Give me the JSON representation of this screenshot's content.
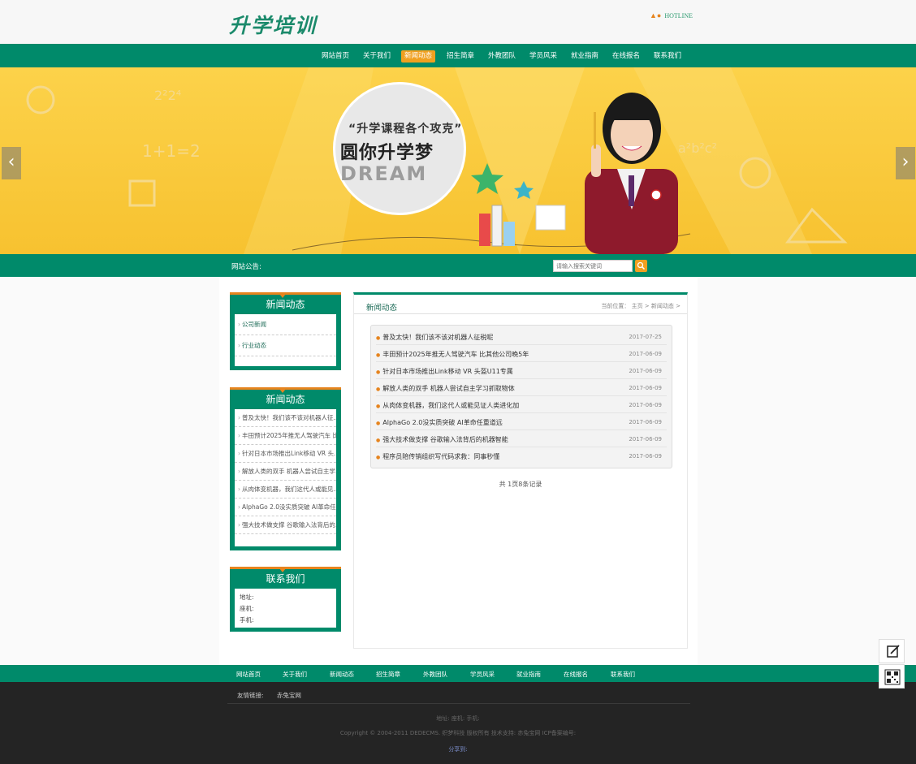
{
  "header": {
    "logo": "升学培训",
    "hotline": "HOTLINE"
  },
  "nav": {
    "items": [
      "网站首页",
      "关于我们",
      "新闻动态",
      "招生简章",
      "外教团队",
      "学员风采",
      "就业指南",
      "在线报名",
      "联系我们"
    ],
    "active": "新闻动态"
  },
  "banner": {
    "line1": "“升学课程各个攻克”",
    "line2": "圆你升学梦",
    "line3": "DREAM"
  },
  "notice": {
    "label": "网站公告:",
    "search_placeholder": "请输入搜索关键词"
  },
  "sidebar": {
    "box1": {
      "title": "新闻动态",
      "items": [
        "公司新闻",
        "行业动态"
      ]
    },
    "box2": {
      "title": "新闻动态",
      "items": [
        "普及太快！我们该不该对机器人征...",
        "丰田预计2025年推无人驾驶汽车 比...",
        "针对日本市场推出Link移动 VR 头...",
        "解放人类的双手 机器人尝试自主学...",
        "从肉体变机器，我们这代人或能见...",
        "AlphaGo 2.0没实质突破 AI革命任...",
        "强大技术做支撑 谷歌输入法背后的..."
      ]
    },
    "box3": {
      "title": "联系我们",
      "items": [
        "地址:",
        "座机:",
        "手机:"
      ]
    }
  },
  "content": {
    "title": "新闻动态",
    "breadcrumb": "当前位置：  主页 >  新闻动态 >",
    "rows": [
      {
        "title": "普及太快！我们该不该对机器人征税呢",
        "date": "2017-07-25"
      },
      {
        "title": "丰田预计2025年推无人驾驶汽车 比其他公司晚5年",
        "date": "2017-06-09"
      },
      {
        "title": "针对日本市场推出Link移动 VR 头盔U11专属",
        "date": "2017-06-09"
      },
      {
        "title": "解放人类的双手 机器人尝试自主学习抓取物体",
        "date": "2017-06-09"
      },
      {
        "title": "从肉体变机器，我们这代人或能见证人类进化加",
        "date": "2017-06-09"
      },
      {
        "title": "AlphaGo 2.0没实质突破 AI革命任重道远",
        "date": "2017-06-09"
      },
      {
        "title": "强大技术做支撑 谷歌输入法背后的机器智能",
        "date": "2017-06-09"
      },
      {
        "title": "程序员陪传销组织写代码求救：同事秒懂",
        "date": "2017-06-09"
      }
    ],
    "pager": "共 1页8条记录"
  },
  "footer": {
    "nav": [
      "网站首页",
      "关于我们",
      "新闻动态",
      "招生简章",
      "外教团队",
      "学员风采",
      "就业指南",
      "在线报名",
      "联系我们"
    ],
    "links_label": "友情链接:",
    "links": [
      "赤兔宝网"
    ],
    "contact": "地址:      座机:      手机:",
    "copyright": "Copyright © 2004-2011 DEDECMS. 织梦科技 版权所有   技术支持: 赤兔宝网   ICP备案编号:",
    "share": "分享到:"
  },
  "colors": {
    "primary": "#008a6a",
    "accent": "#f0a020",
    "banner": "#fcd24a",
    "dark": "#242424"
  }
}
